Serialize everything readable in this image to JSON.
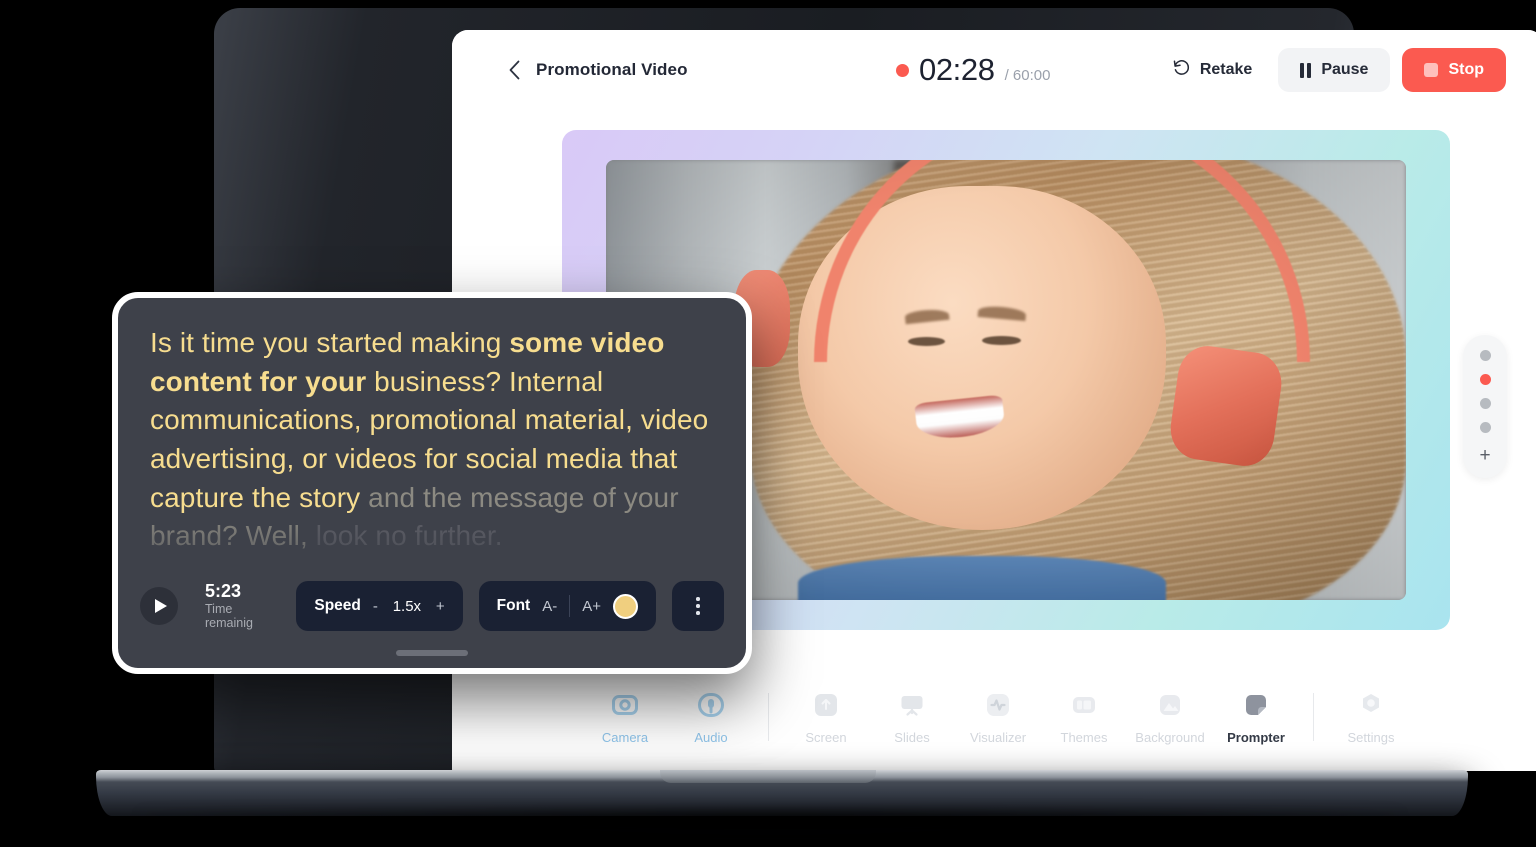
{
  "header": {
    "back_icon": "chevron-left-icon",
    "project_title": "Promotional Video",
    "recording_indicator": "record-dot-icon",
    "elapsed_time": "02:28",
    "total_time": "/ 60:00",
    "retake_label": "Retake",
    "retake_icon": "rotate-ccw-icon",
    "pause_label": "Pause",
    "pause_icon": "pause-icon",
    "stop_label": "Stop",
    "stop_icon": "stop-square-icon",
    "accent_red": "#fb5a50",
    "pause_bg": "#f2f3f5"
  },
  "preview": {
    "frame_gradient_from": "#d9c9f7",
    "frame_gradient_to": "#a9e4ef",
    "subject": "Smiling woman with blonde hair wearing coral over-ear headphones"
  },
  "scene_switcher": {
    "dots": [
      {
        "label": "scene-1",
        "active": false
      },
      {
        "label": "scene-2",
        "active": true
      },
      {
        "label": "scene-3",
        "active": false
      },
      {
        "label": "scene-4",
        "active": false
      }
    ],
    "add_label": "+",
    "active_color": "#fb5a50",
    "inactive_color": "#b7bbc0"
  },
  "toolbar": {
    "tabs": [
      {
        "label": "Camera",
        "icon": "camera-icon",
        "state": "blue"
      },
      {
        "label": "Audio",
        "icon": "microphone-icon",
        "state": "blue"
      },
      {
        "label": "Screen",
        "icon": "screen-share-icon",
        "state": "dim"
      },
      {
        "label": "Slides",
        "icon": "slides-icon",
        "state": "dim"
      },
      {
        "label": "Visualizer",
        "icon": "waveform-icon",
        "state": "dim"
      },
      {
        "label": "Themes",
        "icon": "themes-icon",
        "state": "dim"
      },
      {
        "label": "Background",
        "icon": "image-icon",
        "state": "dim"
      },
      {
        "label": "Prompter",
        "icon": "note-icon",
        "state": "active"
      },
      {
        "label": "Settings",
        "icon": "gear-icon",
        "state": "dim"
      }
    ]
  },
  "prompter": {
    "script_read_1": "Is it time you started making ",
    "script_bold_1": "some video content for your",
    "script_read_2": " business? Internal communications, promotional material, video advertising, or videos for social media that capture the story",
    "script_dim": " and the message of your brand? Well,",
    "script_dimmer": " look no further.",
    "play_icon": "play-icon",
    "time_remaining_value": "5:23",
    "time_remaining_label": "Time remainig",
    "speed_label": "Speed",
    "speed_decrease": "-",
    "speed_value": "1.5x",
    "speed_increase": "+",
    "font_label": "Font",
    "font_decrease": "A-",
    "font_increase": "A+",
    "font_color": "#f0cf7f",
    "more_icon": "more-vertical-icon",
    "text_color": "#f7dd8f",
    "panel_bg": "#3e414a"
  }
}
